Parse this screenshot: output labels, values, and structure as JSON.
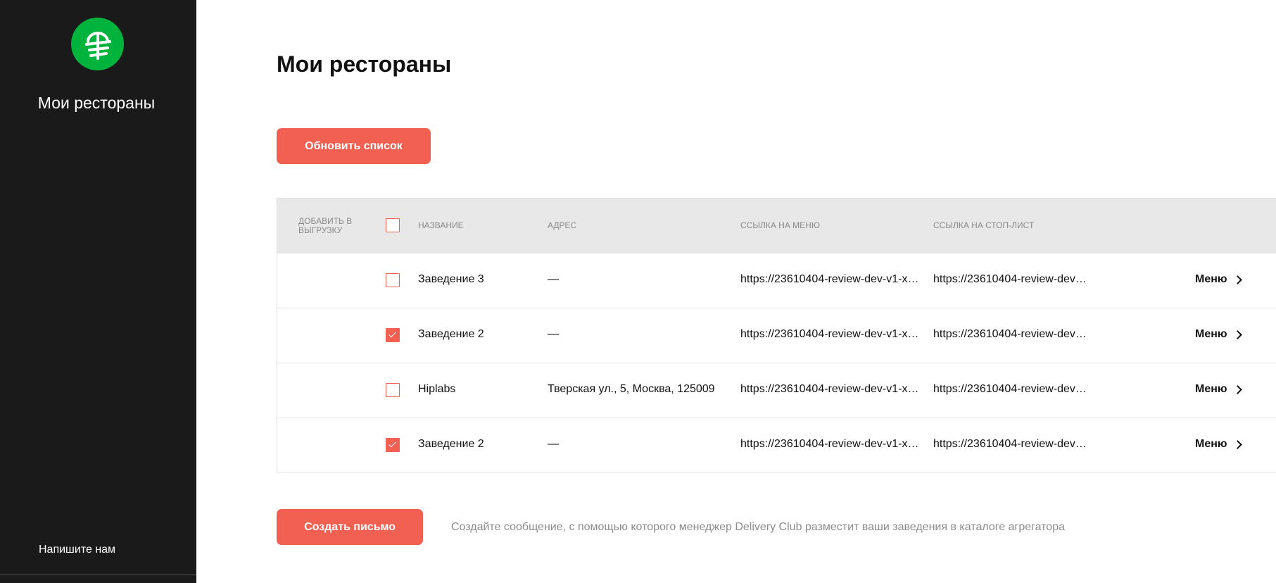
{
  "colors": {
    "sidebar_bg": "#1a1a1a",
    "accent": "#f26052",
    "logo_green": "#00b33c",
    "header_bg": "#e8e8e8"
  },
  "sidebar": {
    "title": "Мои рестораны",
    "contact": "Напишите нам",
    "logo_icon": "delivery-club-logo-icon"
  },
  "page": {
    "title": "Мои рестораны",
    "refresh_label": "Обновить список"
  },
  "table": {
    "headers": {
      "add": "ДОБАВИТЬ В ВЫГРУЗКУ",
      "name": "НАЗВАНИЕ",
      "address": "АДРЕС",
      "menu_link": "ССЫЛКА НА МЕНЮ",
      "stop_link": "ССЫЛКА НА СТОП-ЛИСТ"
    },
    "select_all_checked": false,
    "rows": [
      {
        "checked": false,
        "name": "Заведение 3",
        "address": "—",
        "menu_link": "https://23610404-review-dev-v1-xz…",
        "stop_link": "https://23610404-review-dev-…",
        "action": "Меню"
      },
      {
        "checked": true,
        "name": "Заведение 2",
        "address": "—",
        "menu_link": "https://23610404-review-dev-v1-xz…",
        "stop_link": "https://23610404-review-dev-…",
        "action": "Меню"
      },
      {
        "checked": false,
        "name": "Hiplabs",
        "address": "Тверская ул., 5, Москва, 125009",
        "menu_link": "https://23610404-review-dev-v1-xz…",
        "stop_link": "https://23610404-review-dev-…",
        "action": "Меню"
      },
      {
        "checked": true,
        "name": "Заведение 2",
        "address": "—",
        "menu_link": "https://23610404-review-dev-v1-xz…",
        "stop_link": "https://23610404-review-dev-…",
        "action": "Меню"
      }
    ]
  },
  "footer": {
    "create_letter_label": "Создать письмо",
    "hint": "Создайте сообщение, с помощью которого менеджер Delivery Club разместит ваши заведения в каталоге агрегатора"
  }
}
